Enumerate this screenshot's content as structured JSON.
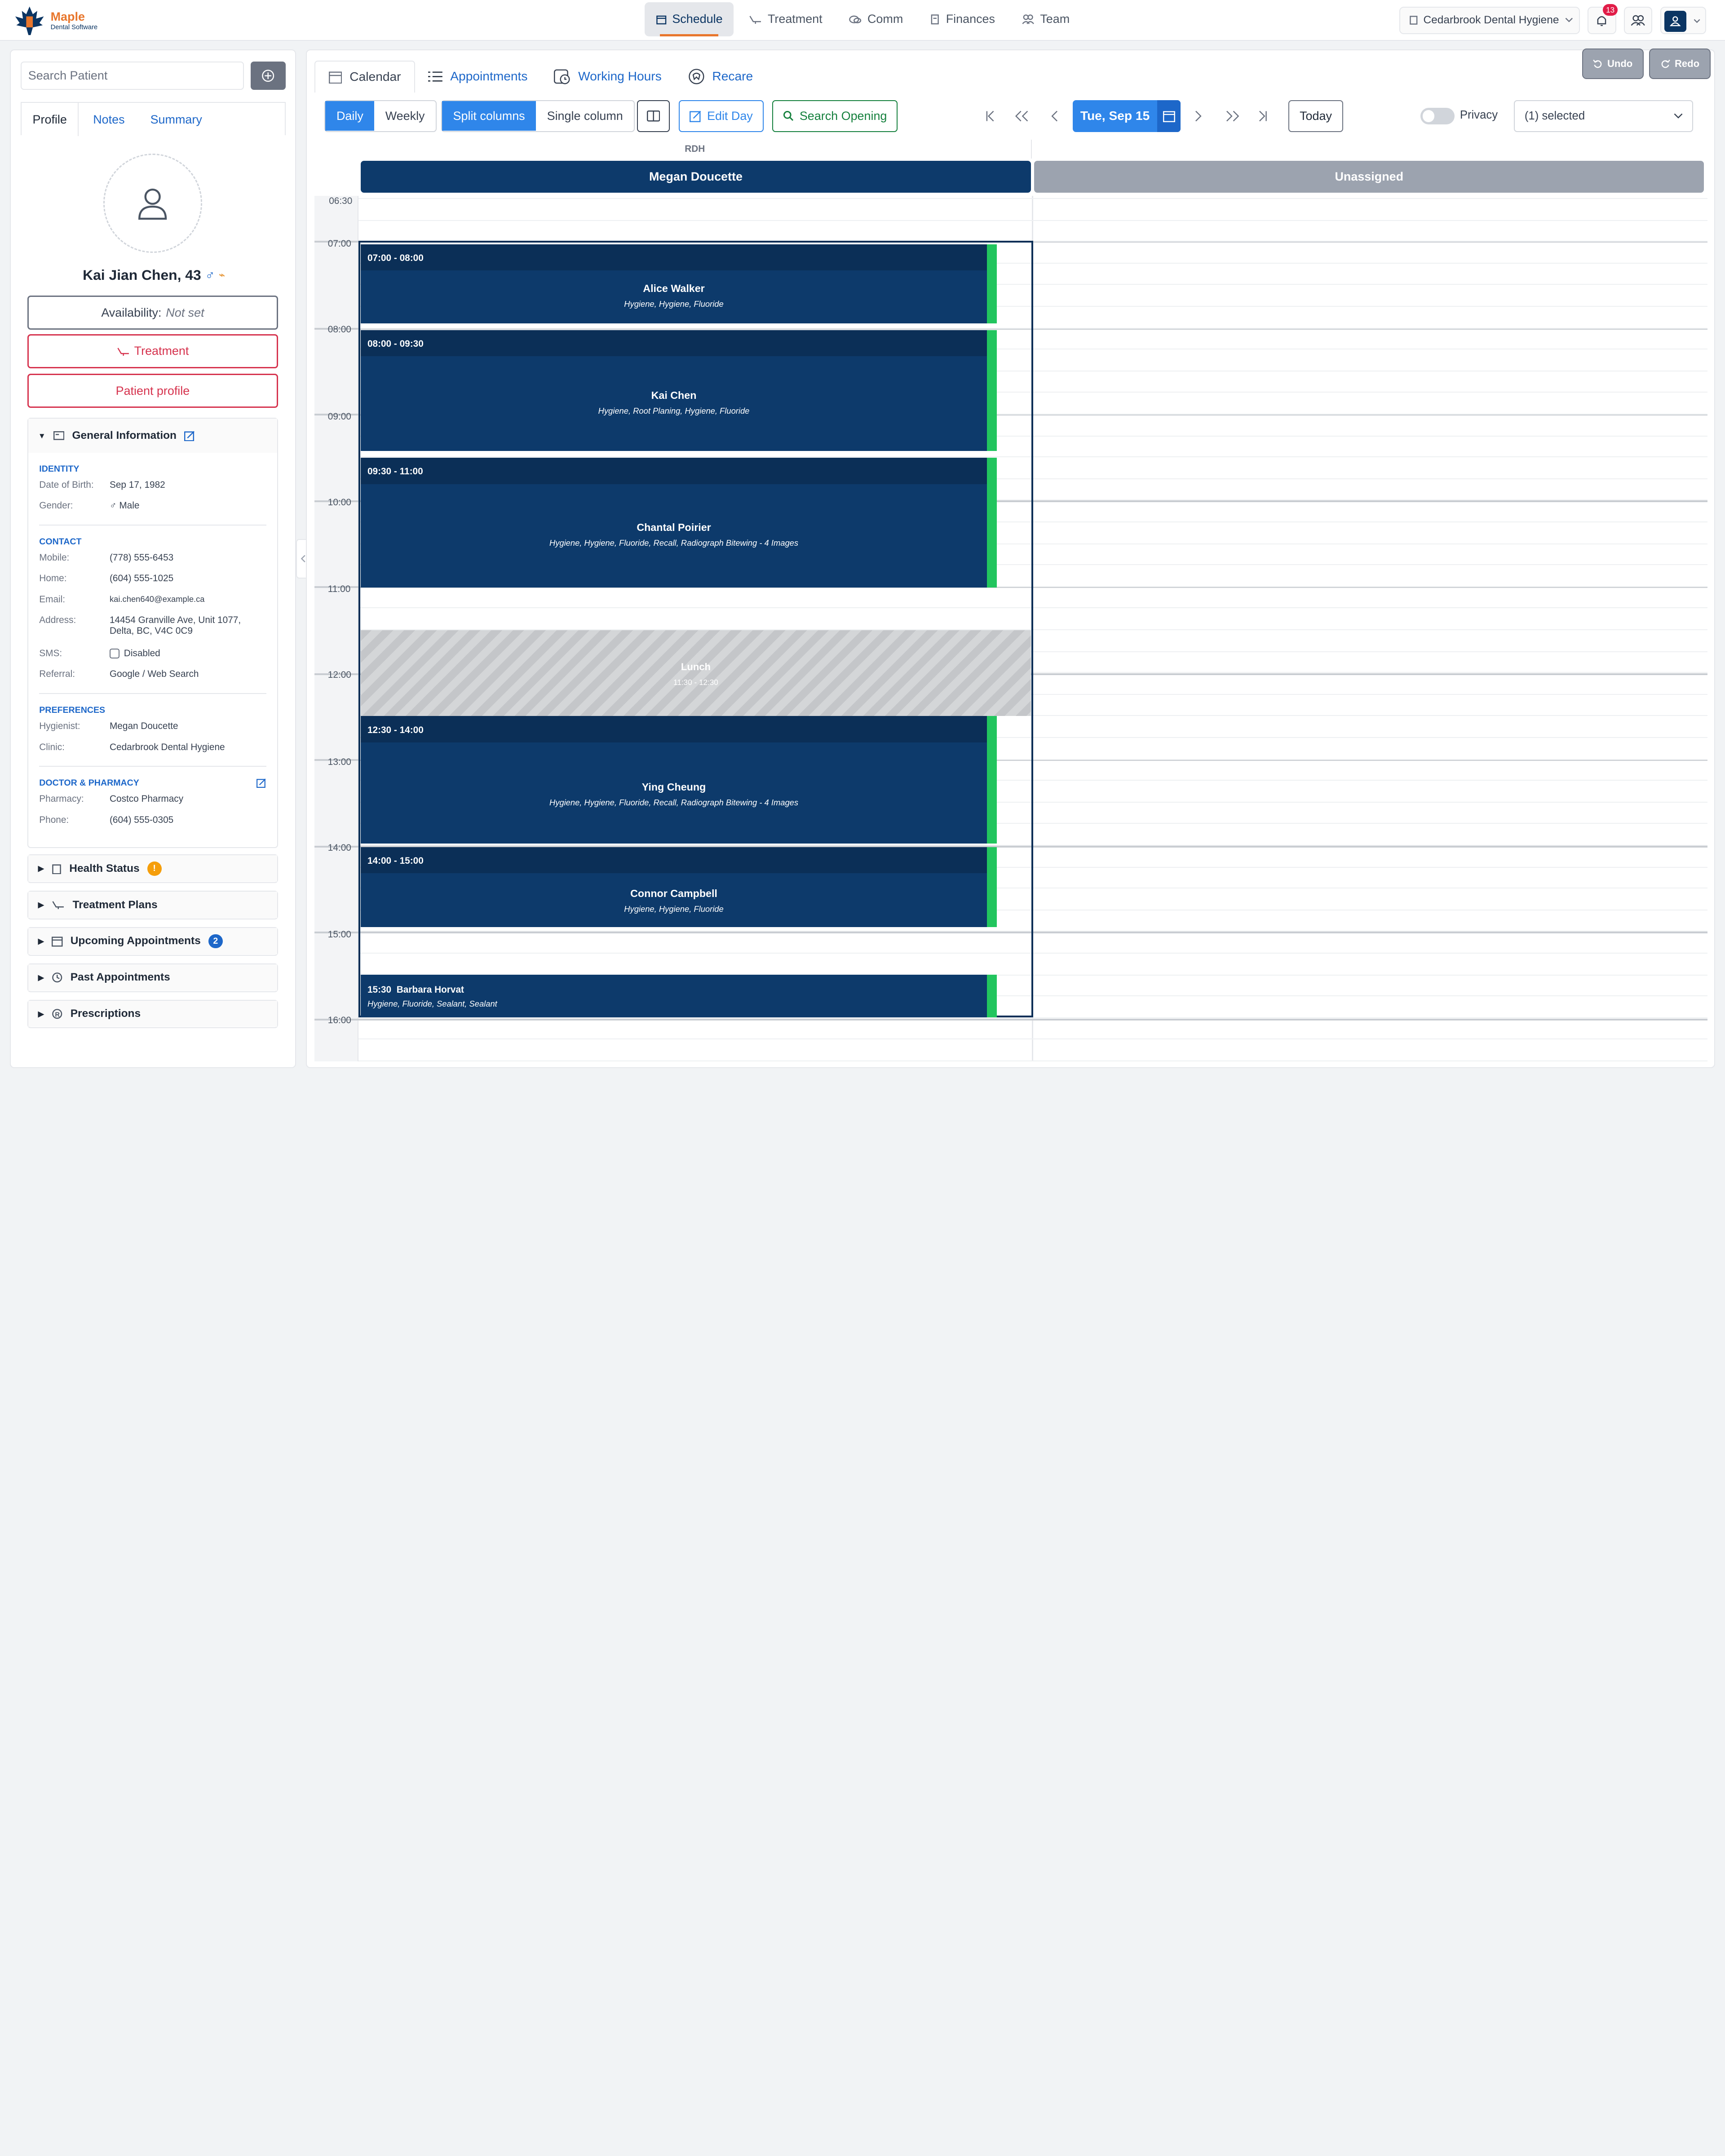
{
  "app": {
    "name": "Maple",
    "tagline": "Dental Software"
  },
  "nav": {
    "items": [
      {
        "label": "Schedule",
        "icon": "calendar-icon",
        "active": true
      },
      {
        "label": "Treatment",
        "icon": "dental-chair-icon"
      },
      {
        "label": "Comm",
        "icon": "chat-icon"
      },
      {
        "label": "Finances",
        "icon": "finance-icon"
      },
      {
        "label": "Team",
        "icon": "team-icon"
      }
    ]
  },
  "header": {
    "clinic": "Cedarbrook Dental Hygiene",
    "notifications": "13"
  },
  "sidebar": {
    "search_placeholder": "Search Patient",
    "tabs": [
      "Profile",
      "Notes",
      "Summary"
    ],
    "patient_name": "Kai Jian Chen, 43",
    "availability_label": "Availability:",
    "availability_value": "Not set",
    "treatment_button": "Treatment",
    "profile_button": "Patient profile",
    "general": {
      "title": "General Information",
      "identity_heading": "IDENTITY",
      "dob_label": "Date of Birth:",
      "dob": "Sep 17, 1982",
      "gender_label": "Gender:",
      "gender": "♂ Male",
      "contact_heading": "CONTACT",
      "mobile_label": "Mobile:",
      "mobile": "(778) 555-6453",
      "home_label": "Home:",
      "home": "(604) 555-1025",
      "email_label": "Email:",
      "email": "kai.chen640@example.ca",
      "address_label": "Address:",
      "address1": "14454 Granville Ave, Unit 1077,",
      "address2": "Delta, BC, V4C 0C9",
      "sms_label": "SMS:",
      "sms": "Disabled",
      "referral_label": "Referral:",
      "referral": "Google / Web Search",
      "pref_heading": "PREFERENCES",
      "hygienist_label": "Hygienist:",
      "hygienist": "Megan Doucette",
      "clinic_label": "Clinic:",
      "clinic": "Cedarbrook Dental Hygiene",
      "doctor_heading": "DOCTOR & PHARMACY",
      "pharmacy_label": "Pharmacy:",
      "pharmacy": "Costco Pharmacy",
      "phone_label": "Phone:",
      "phone": "(604) 555-0305"
    },
    "sections": {
      "health": "Health Status",
      "health_badge": "!",
      "plans": "Treatment Plans",
      "upcoming": "Upcoming Appointments",
      "upcoming_count": "2",
      "past": "Past Appointments",
      "prescriptions": "Prescriptions"
    }
  },
  "toolbar": {
    "undo": "Undo",
    "redo": "Redo",
    "tabs": [
      "Calendar",
      "Appointments",
      "Working Hours",
      "Recare"
    ],
    "daily": "Daily",
    "weekly": "Weekly",
    "split": "Split columns",
    "single": "Single column",
    "edit_day": "Edit Day",
    "search_opening": "Search Opening",
    "date": "Tue, Sep 15",
    "today": "Today",
    "privacy": "Privacy",
    "selected": "(1) selected"
  },
  "calendar": {
    "group": "RDH",
    "columns": [
      "Megan Doucette",
      "Unassigned"
    ],
    "column_colors": [
      "#0d3a6b",
      "#9ca3af"
    ],
    "times": [
      "06:30",
      "07:00",
      "08:00",
      "09:00",
      "10:00",
      "11:00",
      "12:00",
      "13:00",
      "14:00",
      "15:00",
      "16:00"
    ],
    "appointments": [
      {
        "time": "07:00 - 08:00",
        "name": "Alice Walker",
        "procedures": "Hygiene, Hygiene, Fluoride"
      },
      {
        "time": "08:00 - 09:30",
        "name": "Kai Chen",
        "procedures": "Hygiene, Root Planing, Hygiene, Fluoride"
      },
      {
        "time": "09:30 - 11:00",
        "name": "Chantal Poirier",
        "procedures": "Hygiene, Hygiene, Fluoride, Recall, Radiograph Bitewing - 4 Images"
      },
      {
        "time": "12:30 - 14:00",
        "name": "Ying Cheung",
        "procedures": "Hygiene, Hygiene, Fluoride, Recall, Radiograph Bitewing - 4 Images"
      },
      {
        "time": "14:00 - 15:00",
        "name": "Connor Campbell",
        "procedures": "Hygiene, Hygiene, Fluoride"
      },
      {
        "time": "15:30",
        "name": "Barbara Horvat",
        "procedures": "Hygiene, Fluoride, Sealant, Sealant"
      }
    ],
    "lunch": {
      "label": "Lunch",
      "time": "11:30 - 12:30"
    }
  }
}
